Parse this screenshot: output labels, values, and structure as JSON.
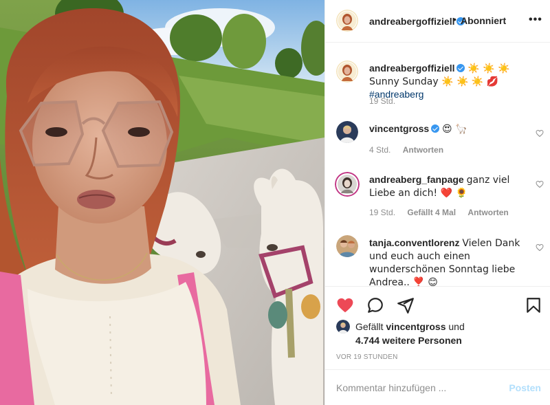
{
  "header": {
    "username": "andreabergoffiziell",
    "separator": "•",
    "follow_label": "Abonniert",
    "more_label": "•••"
  },
  "caption": {
    "username": "andreabergoffiziell",
    "text": "☀️ ☀️ ☀️ Sunny Sunday ☀️ ☀️ ☀️ 💋",
    "hashtag": "#andreaberg",
    "time": "19 Std."
  },
  "comments": [
    {
      "username": "vincentgross",
      "text": "😍 🦙",
      "time": "4 Std.",
      "reply_label": "Antworten",
      "likes_label": ""
    },
    {
      "username": "andreaberg_fanpage",
      "text": "ganz viel Liebe an dich! ❤️ 🌻",
      "time": "19 Std.",
      "likes_label": "Gefällt 4 Mal",
      "reply_label": "Antworten"
    },
    {
      "username": "tanja.conventlorenz",
      "text": "Vielen Dank und euch auch einen wunderschönen Sonntag liebe Andrea.. ❣️ 😊"
    }
  ],
  "likes": {
    "prefix": "Gefällt",
    "first_user": "vincentgross",
    "conjunction": "und",
    "others": "4.744 weitere Personen"
  },
  "time_ago": "VOR 19 STUNDEN",
  "composer": {
    "placeholder": "Kommentar hinzufügen ...",
    "post_label": "Posten"
  },
  "colors": {
    "like_red": "#ed4956",
    "verified_blue": "#3897f0",
    "hashtag_blue": "#00376b",
    "post_disabled": "#b2dffc"
  },
  "icons": [
    "heart-filled-icon",
    "comment-icon",
    "share-icon",
    "bookmark-icon",
    "verified-icon",
    "heart-outline-icon"
  ]
}
